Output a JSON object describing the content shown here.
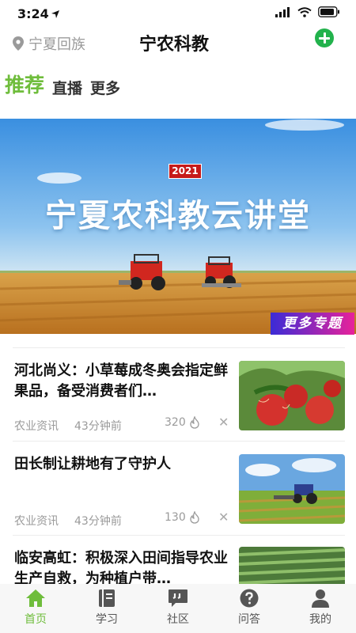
{
  "status": {
    "time": "3:24"
  },
  "header": {
    "location": "宁夏回族",
    "title": "宁农科教"
  },
  "tabs": [
    {
      "label": "推荐"
    },
    {
      "label": "直播"
    },
    {
      "label": "更多"
    }
  ],
  "banner": {
    "year": "2021",
    "title": "宁夏农科教云讲堂",
    "more_label": "更多专题"
  },
  "articles": [
    {
      "title": "河北尚义：小草莓成冬奥会指定鲜果品，备受消费者们…",
      "category": "农业资讯",
      "time": "43分钟前",
      "count": "320"
    },
    {
      "title": "田长制让耕地有了守护人",
      "category": "农业资讯",
      "time": "43分钟前",
      "count": "130"
    },
    {
      "title": "临安高虹：积极深入田间指导农业生产自救，为种植户带…"
    }
  ],
  "nav": [
    {
      "label": "首页"
    },
    {
      "label": "学习"
    },
    {
      "label": "社区"
    },
    {
      "label": "问答"
    },
    {
      "label": "我的"
    }
  ],
  "colors": {
    "accent": "#6fbd3c",
    "add_button": "#22b24c",
    "more_topics_from": "#3b2bd6",
    "more_topics_to": "#e8229a"
  }
}
